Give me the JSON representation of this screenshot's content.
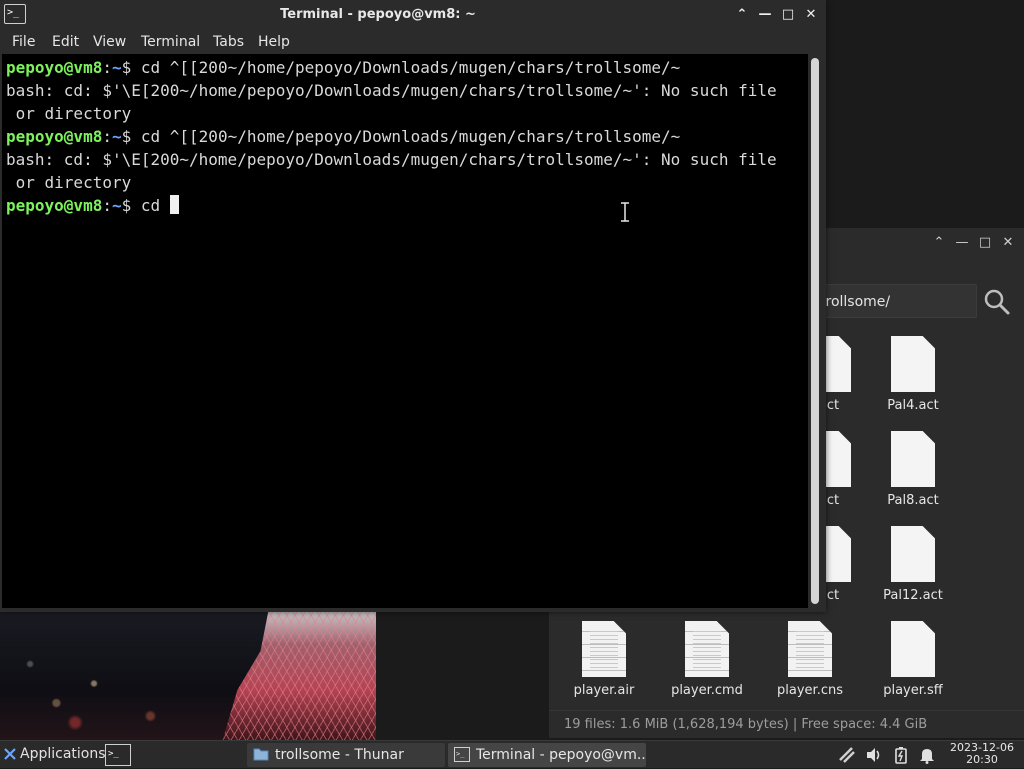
{
  "terminal": {
    "title": "Terminal - pepoyo@vm8: ~",
    "icon_glyph": ">_",
    "menu": [
      "File",
      "Edit",
      "View",
      "Terminal",
      "Tabs",
      "Help"
    ],
    "lines": [
      {
        "type": "prompt",
        "user": "pepoyo@vm8",
        "sep": ":",
        "path": "~",
        "symbol": "$ ",
        "cmd": "cd ^[[200~/home/pepoyo/Downloads/mugen/chars/trollsome/~"
      },
      {
        "type": "output",
        "text": "bash: cd: $'\\E[200~/home/pepoyo/Downloads/mugen/chars/trollsome/~': No such file"
      },
      {
        "type": "output",
        "text": " or directory"
      },
      {
        "type": "prompt",
        "user": "pepoyo@vm8",
        "sep": ":",
        "path": "~",
        "symbol": "$ ",
        "cmd": "cd ^[[200~/home/pepoyo/Downloads/mugen/chars/trollsome/~"
      },
      {
        "type": "output",
        "text": "bash: cd: $'\\E[200~/home/pepoyo/Downloads/mugen/chars/trollsome/~': No such file"
      },
      {
        "type": "output",
        "text": " or directory"
      },
      {
        "type": "prompt",
        "user": "pepoyo@vm8",
        "sep": ":",
        "path": "~",
        "symbol": "$ ",
        "cmd": "cd ",
        "cursor": true
      }
    ]
  },
  "thunar": {
    "path": "trollsome/",
    "files": [
      {
        "name": "act",
        "kind": "blank"
      },
      {
        "name": "Pal4.act",
        "kind": "blank"
      },
      {
        "name": "act",
        "kind": "blank"
      },
      {
        "name": "Pal8.act",
        "kind": "blank"
      },
      {
        "name": "act",
        "kind": "blank"
      },
      {
        "name": "Pal12.act",
        "kind": "blank"
      },
      {
        "name": "player.air",
        "kind": "text"
      },
      {
        "name": "player.cmd",
        "kind": "text"
      },
      {
        "name": "player.cns",
        "kind": "text"
      },
      {
        "name": "player.sff",
        "kind": "blank"
      }
    ],
    "status": "19 files: 1.6 MiB (1,628,194 bytes)  |  Free space: 4.4 GiB"
  },
  "taskbar": {
    "applications_label": "Applications",
    "tasks": [
      {
        "label": "trollsome - Thunar",
        "icon": "folder-icon",
        "active": false
      },
      {
        "label": "Terminal - pepoyo@vm...",
        "icon": "terminal-icon",
        "active": true
      }
    ],
    "clock_date": "2023-12-06",
    "clock_time": "20:30"
  },
  "colors": {
    "prompt_user": "#7df25c",
    "prompt_path": "#6aa5ff",
    "terminal_bg": "#000000",
    "chrome_bg": "#2b2b2b"
  }
}
